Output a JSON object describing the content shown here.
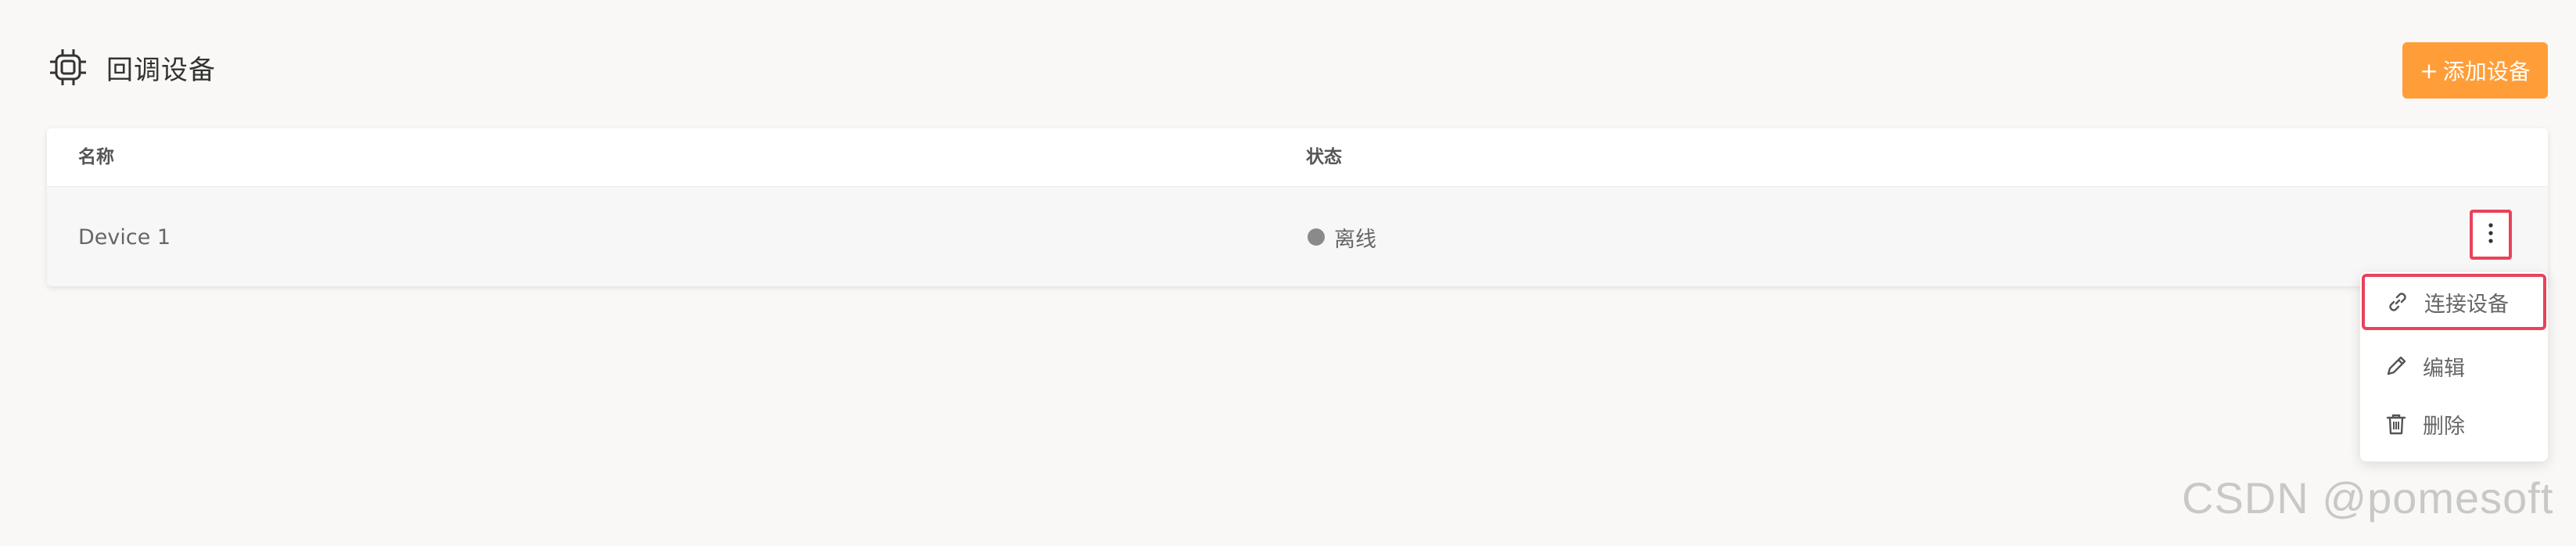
{
  "header": {
    "icon": "chip-icon",
    "title": "回调设备"
  },
  "toolbar": {
    "add_prefix": "+",
    "add_label": "添加设备"
  },
  "table": {
    "columns": [
      "名称",
      "状态"
    ],
    "rows": [
      {
        "name": "Device 1",
        "status": "离线",
        "status_color": "#8a8a8a"
      }
    ]
  },
  "row_menu": {
    "items": [
      {
        "icon": "link-icon",
        "label": "连接设备"
      },
      {
        "icon": "pencil-icon",
        "label": "编辑"
      },
      {
        "icon": "trash-icon",
        "label": "删除"
      }
    ]
  },
  "watermark": "CSDN @pomesoft",
  "colors": {
    "accent": "#ff9e38",
    "highlight": "#e8435a",
    "background": "#f9f8f6"
  }
}
